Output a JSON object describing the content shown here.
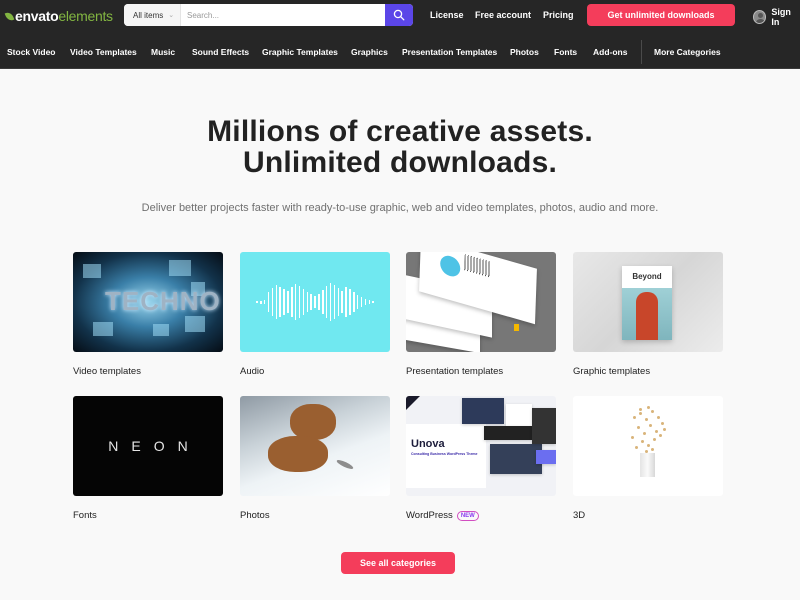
{
  "header": {
    "logo": {
      "part1": "envato",
      "part2": "elements"
    },
    "search": {
      "category": "All items",
      "placeholder": "Search..."
    },
    "links": [
      "License",
      "Free account",
      "Pricing"
    ],
    "cta_label": "Get unlimited downloads",
    "signin_label": "Sign In"
  },
  "category_nav": {
    "items": [
      "Stock Video",
      "Video Templates",
      "Music",
      "Sound Effects",
      "Graphic Templates",
      "Graphics",
      "Presentation Templates",
      "Photos",
      "Fonts",
      "Add-ons"
    ],
    "more_label": "More Categories"
  },
  "hero": {
    "title_line1": "Millions of creative assets.",
    "title_line2": "Unlimited downloads.",
    "subtitle": "Deliver better projects faster with ready-to-use graphic, web and video templates, photos, audio and more."
  },
  "categories": [
    {
      "label": "Video templates",
      "thumb_text": "TECHNO"
    },
    {
      "label": "Audio"
    },
    {
      "label": "Presentation templates"
    },
    {
      "label": "Graphic templates",
      "thumb_text": "Beyond"
    },
    {
      "label": "Fonts",
      "thumb_text": "NEON"
    },
    {
      "label": "Photos"
    },
    {
      "label": "WordPress",
      "badge": "NEW",
      "thumb_text": "Unova",
      "thumb_subtext": "Consulting Business WordPress Theme"
    },
    {
      "label": "3D"
    }
  ],
  "see_all_label": "See all categories",
  "colors": {
    "header_bg": "#262626",
    "accent_red": "#f43d5b",
    "search_button": "#5b46e8",
    "brand_green": "#82b541",
    "audio_bg": "#70e8f0"
  }
}
